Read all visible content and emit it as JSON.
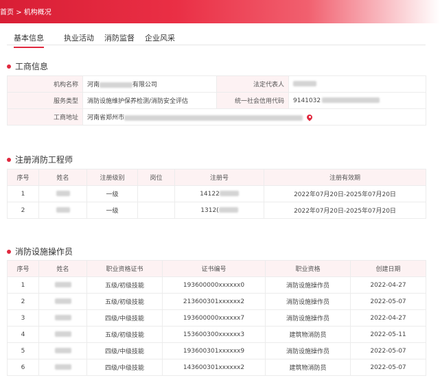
{
  "breadcrumb": {
    "home": "首页",
    "separator": ">",
    "current": "机构概况"
  },
  "tabs": [
    "基本信息",
    "执业活动",
    "消防监督",
    "企业风采"
  ],
  "business": {
    "title": "工商信息",
    "rows": [
      {
        "label1": "机构名称",
        "value1_pre": "河南",
        "value1_post": "有限公司",
        "label2": "法定代表人"
      },
      {
        "label1": "服务类型",
        "value1": "消防设施维护保养检测/消防安全评估",
        "label2": "统一社会信用代码",
        "value2_pre": "9141032"
      },
      {
        "label1": "工商地址",
        "value1_pre": "河南省郑州市"
      }
    ]
  },
  "engineers": {
    "title": "注册消防工程师",
    "headers": [
      "序号",
      "姓名",
      "注册级别",
      "岗位",
      "注册号",
      "注册有效期"
    ],
    "rows": [
      {
        "no": "1",
        "level": "一级",
        "post": "",
        "reg_prefix": "14122",
        "validity": "2022年07月20日-2025年07月20日"
      },
      {
        "no": "2",
        "level": "一级",
        "post": "",
        "reg_prefix": "1312(",
        "validity": "2022年07月20日-2025年07月20日"
      }
    ]
  },
  "operators": {
    "title": "消防设施操作员",
    "headers": [
      "序号",
      "姓名",
      "职业资格证书",
      "证书编号",
      "职业资格",
      "创建日期"
    ],
    "rows": [
      {
        "no": "1",
        "cert": "五级/初级技能",
        "cert_no": "193600000xxxxxx0",
        "qual": "消防设施操作员",
        "date": "2022-04-27"
      },
      {
        "no": "2",
        "cert": "五级/初级技能",
        "cert_no": "213600301xxxxxx2",
        "qual": "消防设施操作员",
        "date": "2022-05-07"
      },
      {
        "no": "3",
        "cert": "四级/中级技能",
        "cert_no": "193600000xxxxxx7",
        "qual": "消防设施操作员",
        "date": "2022-04-27"
      },
      {
        "no": "4",
        "cert": "五级/初级技能",
        "cert_no": "153600300xxxxxx3",
        "qual": "建筑物消防员",
        "date": "2022-05-11"
      },
      {
        "no": "5",
        "cert": "四级/中级技能",
        "cert_no": "193600301xxxxxx9",
        "qual": "消防设施操作员",
        "date": "2022-05-07"
      },
      {
        "no": "6",
        "cert": "四级/中级技能",
        "cert_no": "143600301xxxxxx2",
        "qual": "建筑物消防员",
        "date": "2022-05-07"
      }
    ]
  },
  "colors": {
    "accent": "#e0283e",
    "header_bg": "#fdf2f3"
  }
}
